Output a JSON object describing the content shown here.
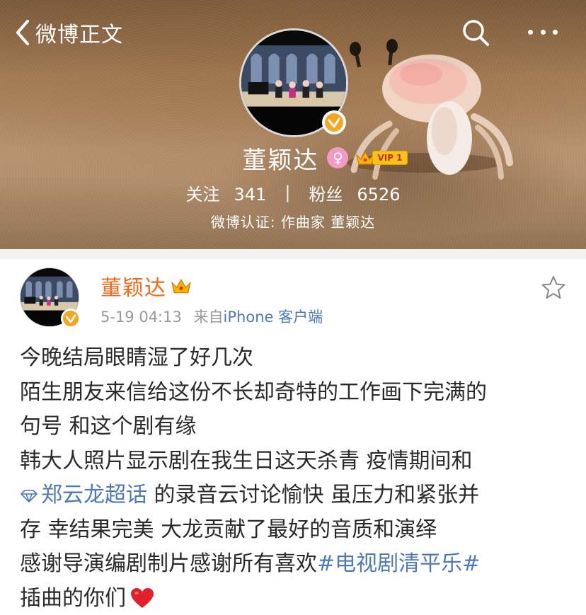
{
  "header": {
    "back_label": "微博正文",
    "icons": {
      "back": "chevron-left-icon",
      "search": "search-icon",
      "more": "more-dots-icon"
    }
  },
  "profile": {
    "name": "董颖达",
    "gender_icon": "female-symbol-icon",
    "vip_label": "VIP 1",
    "following_label": "关注",
    "following_count": "341",
    "stats_divider": "|",
    "followers_label": "粉丝",
    "followers_count": "6526",
    "verification": "微博认证: 作曲家 董颖达"
  },
  "post": {
    "author": "董颖达",
    "time": "5-19 04:13",
    "source_prefix": "来自",
    "source": "iPhone 客户端",
    "lines": [
      "今晚结局眼睛湿了好几次",
      "陌生朋友来信给这份不长却奇特的工作画下完满的",
      "句号 和这个剧有缘",
      "韩大人照片显示剧在我生日这天杀青 疫情期间和"
    ],
    "line5_topic": "郑云龙超话",
    "line5_rest": " 的录音云讨论愉快 虽压力和紧张并",
    "line6": "存 幸结果完美 大龙贡献了最好的音质和演绎",
    "line7_text": "感谢导演编剧制片感谢所有喜欢",
    "line7_hashtag": "#电视剧清平乐#",
    "line8_text": "插曲的你们"
  },
  "colors": {
    "author": "#f26b1d",
    "link": "#4e79b5",
    "meta": "#999999",
    "body_text": "#2a2a2a",
    "verified_badge": "#f5a623",
    "heart": "#e0202b",
    "separator": "#f2f2f2"
  }
}
